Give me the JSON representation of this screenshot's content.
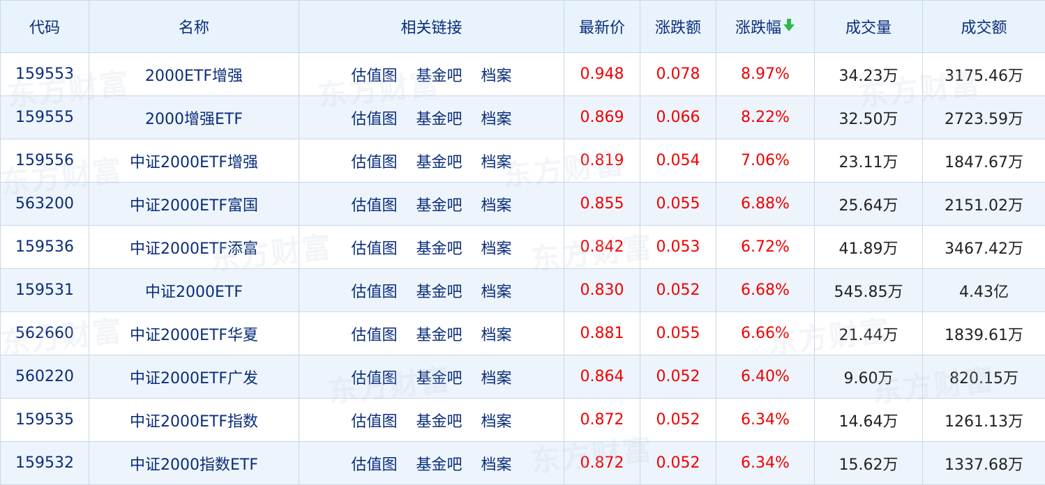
{
  "table": {
    "headers": {
      "code": "代码",
      "name": "名称",
      "links": "相关链接",
      "price": "最新价",
      "change": "涨跌额",
      "change_pct": "涨跌幅",
      "volume": "成交量",
      "turnover": "成交额"
    },
    "sort_icon": "arrow-down-icon",
    "sort_color": "#2eb84a",
    "link_labels": [
      "估值图",
      "基金吧",
      "档案"
    ],
    "rows": [
      {
        "code": "159553",
        "name": "2000ETF增强",
        "price": "0.948",
        "change": "0.078",
        "change_pct": "8.97%",
        "volume": "34.23万",
        "turnover": "3175.46万"
      },
      {
        "code": "159555",
        "name": "2000增强ETF",
        "price": "0.869",
        "change": "0.066",
        "change_pct": "8.22%",
        "volume": "32.50万",
        "turnover": "2723.59万"
      },
      {
        "code": "159556",
        "name": "中证2000ETF增强",
        "price": "0.819",
        "change": "0.054",
        "change_pct": "7.06%",
        "volume": "23.11万",
        "turnover": "1847.67万"
      },
      {
        "code": "563200",
        "name": "中证2000ETF富国",
        "price": "0.855",
        "change": "0.055",
        "change_pct": "6.88%",
        "volume": "25.64万",
        "turnover": "2151.02万"
      },
      {
        "code": "159536",
        "name": "中证2000ETF添富",
        "price": "0.842",
        "change": "0.053",
        "change_pct": "6.72%",
        "volume": "41.89万",
        "turnover": "3467.42万"
      },
      {
        "code": "159531",
        "name": "中证2000ETF",
        "price": "0.830",
        "change": "0.052",
        "change_pct": "6.68%",
        "volume": "545.85万",
        "turnover": "4.43亿"
      },
      {
        "code": "562660",
        "name": "中证2000ETF华夏",
        "price": "0.881",
        "change": "0.055",
        "change_pct": "6.66%",
        "volume": "21.44万",
        "turnover": "1839.61万"
      },
      {
        "code": "560220",
        "name": "中证2000ETF广发",
        "price": "0.864",
        "change": "0.052",
        "change_pct": "6.40%",
        "volume": "9.60万",
        "turnover": "820.15万"
      },
      {
        "code": "159535",
        "name": "中证2000ETF指数",
        "price": "0.872",
        "change": "0.052",
        "change_pct": "6.34%",
        "volume": "14.64万",
        "turnover": "1261.13万"
      },
      {
        "code": "159532",
        "name": "中证2000指数ETF",
        "price": "0.872",
        "change": "0.052",
        "change_pct": "6.34%",
        "volume": "15.62万",
        "turnover": "1337.68万"
      }
    ]
  },
  "colors": {
    "header_bg": "#e9f3fd",
    "link_text": "#0a2d7a",
    "up_red": "#f00000",
    "stripe_bg": "#edf4fc",
    "border": "#c9d7e8"
  },
  "watermark": "东方财富"
}
